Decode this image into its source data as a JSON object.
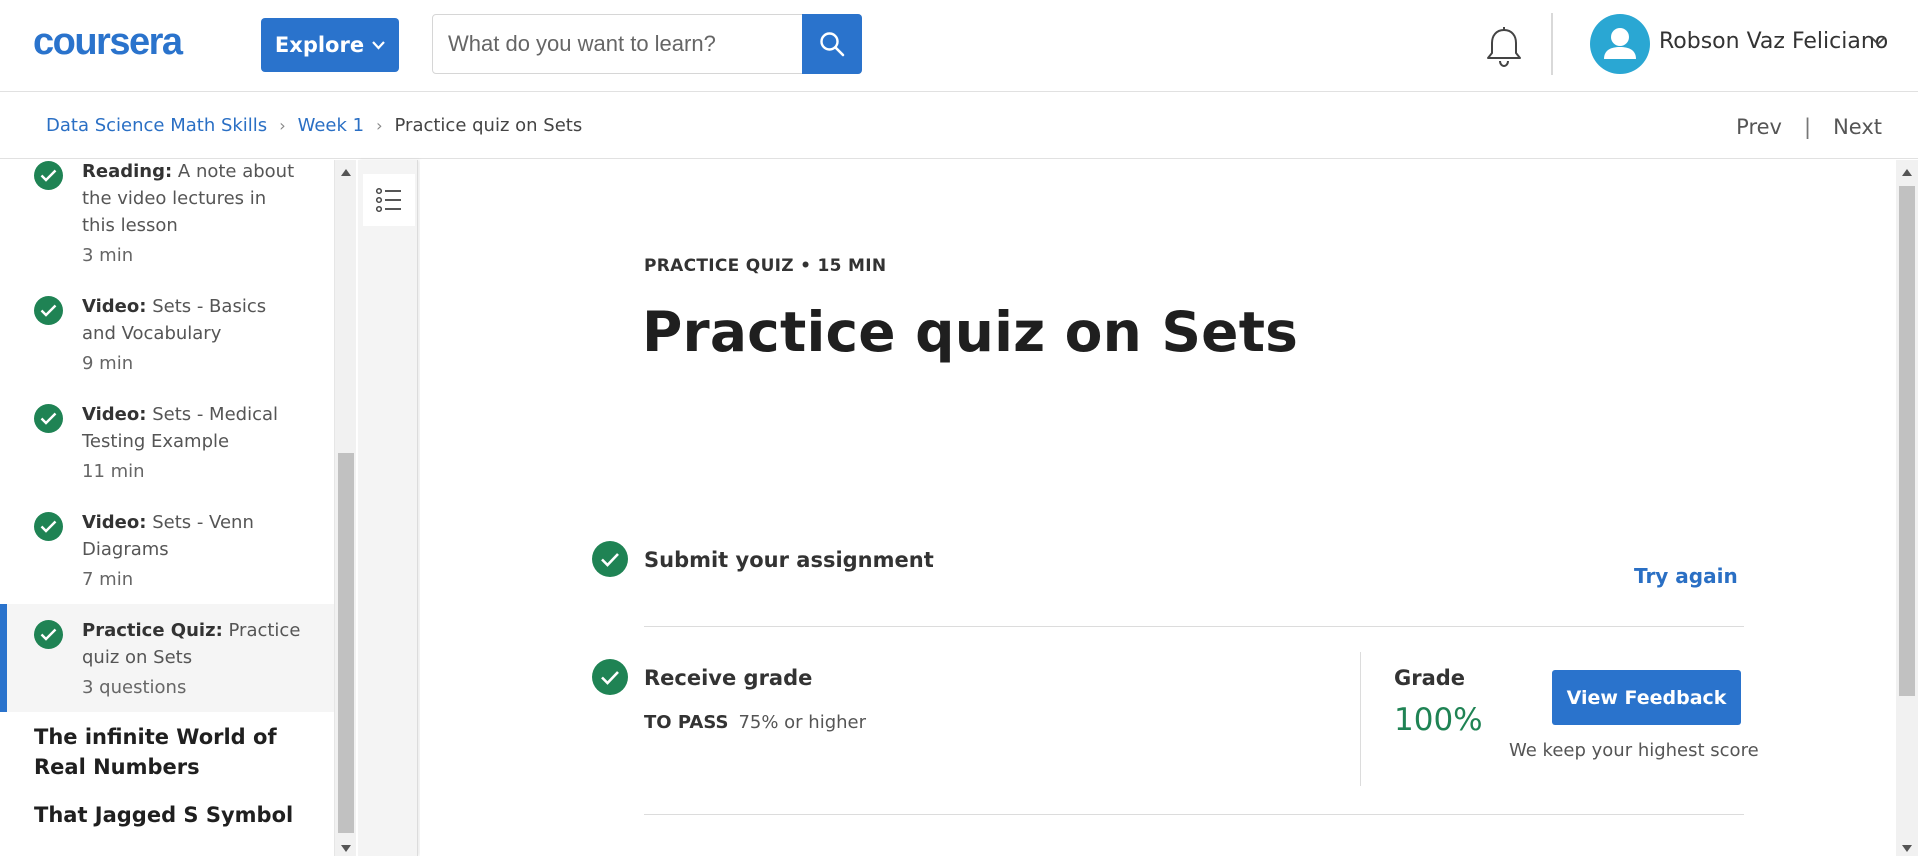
{
  "header": {
    "logo_text": "coursera",
    "explore_label": "Explore",
    "search_placeholder": "What do you want to learn?",
    "user_name": "Robson Vaz Feliciano",
    "icons": [
      "search-icon",
      "bell-icon",
      "avatar-icon",
      "chevron-down-icon"
    ]
  },
  "breadcrumb": {
    "items": [
      "Data Science Math Skills",
      "Week 1",
      "Practice quiz on Sets"
    ],
    "prev_label": "Prev",
    "separator": "|",
    "next_label": "Next"
  },
  "sidebar": {
    "items": [
      {
        "kind": "Reading:",
        "title": "A note about the video lectures in this lesson",
        "duration": "3 min"
      },
      {
        "kind": "Video:",
        "title": "Sets - Basics and Vocabulary",
        "duration": "9 min"
      },
      {
        "kind": "Video:",
        "title": "Sets - Medical Testing Example",
        "duration": "11 min"
      },
      {
        "kind": "Video:",
        "title": "Sets - Venn Diagrams",
        "duration": "7 min"
      },
      {
        "kind": "Practice Quiz:",
        "title": "Practice quiz on Sets",
        "duration": "3 questions"
      }
    ],
    "lessons": [
      "The infinite World of Real Numbers",
      "That Jagged S Symbol"
    ]
  },
  "main": {
    "eyebrow": "PRACTICE QUIZ • 15 MIN",
    "title": "Practice quiz on Sets",
    "submit_label": "Submit your assignment",
    "try_again_label": "Try again",
    "receive_label": "Receive grade",
    "to_pass_label": "TO PASS",
    "to_pass_value": "75% or higher",
    "grade_label": "Grade",
    "grade_value": "100%",
    "feedback_button": "View Feedback",
    "keep_note": "We keep your highest score"
  },
  "colors": {
    "brand_blue": "#2a73cc",
    "success_green": "#1f8354",
    "link_blue": "#2a6fc4"
  }
}
